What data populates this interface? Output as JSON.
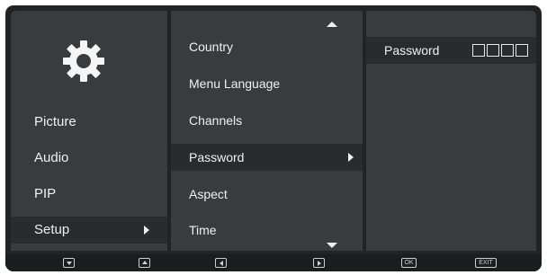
{
  "left_menu": {
    "gear_icon": "gear-icon",
    "items": [
      {
        "label": "Picture"
      },
      {
        "label": "Audio"
      },
      {
        "label": "PIP"
      },
      {
        "label": "Setup",
        "selected": true
      }
    ]
  },
  "middle_menu": {
    "items": [
      {
        "label": "Country"
      },
      {
        "label": "Menu Language"
      },
      {
        "label": "Channels"
      },
      {
        "label": "Password",
        "selected": true
      },
      {
        "label": "Aspect"
      },
      {
        "label": "Time"
      }
    ]
  },
  "right_panel": {
    "password_label": "Password",
    "password_boxes": 4
  },
  "bottom_bar": {
    "buttons": [
      {
        "name": "down-button",
        "icon": "down-triangle-icon"
      },
      {
        "name": "up-button",
        "icon": "up-triangle-icon"
      },
      {
        "name": "left-button",
        "icon": "left-triangle-icon"
      },
      {
        "name": "right-button",
        "icon": "right-triangle-icon"
      },
      {
        "name": "ok-button",
        "label": "OK"
      },
      {
        "name": "exit-button",
        "label": "EXIT"
      }
    ]
  }
}
